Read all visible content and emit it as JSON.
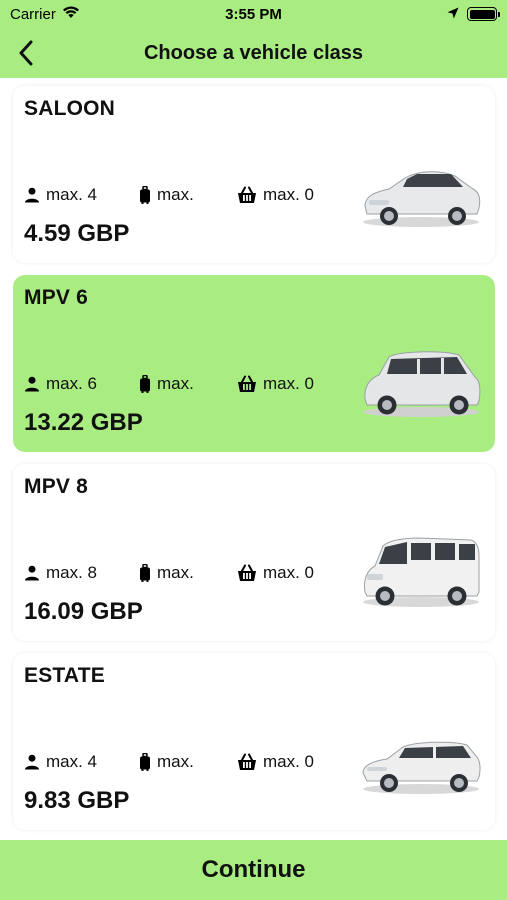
{
  "status_bar": {
    "carrier": "Carrier",
    "time": "3:55 PM"
  },
  "nav": {
    "title": "Choose a vehicle class"
  },
  "vehicles": [
    {
      "name": "SALOON",
      "passengers": "max. 4",
      "luggage": "max.",
      "hand_luggage": "max. 0",
      "price": "4.59 GBP",
      "selected": false,
      "car_color": "#e8e9ea"
    },
    {
      "name": "MPV 6",
      "passengers": "max. 6",
      "luggage": "max.",
      "hand_luggage": "max. 0",
      "price": "13.22 GBP",
      "selected": true,
      "car_color": "#e4e6e8"
    },
    {
      "name": "MPV 8",
      "passengers": "max. 8",
      "luggage": "max.",
      "hand_luggage": "max. 0",
      "price": "16.09 GBP",
      "selected": false,
      "car_color": "#f1f1f1"
    },
    {
      "name": "ESTATE",
      "passengers": "max. 4",
      "luggage": "max.",
      "hand_luggage": "max. 0",
      "price": "9.83 GBP",
      "selected": false,
      "car_color": "#eeeeee"
    }
  ],
  "footer": {
    "continue_label": "Continue"
  },
  "colors": {
    "accent": "#a9ed82",
    "card": "#ffffff",
    "text": "#111111"
  }
}
